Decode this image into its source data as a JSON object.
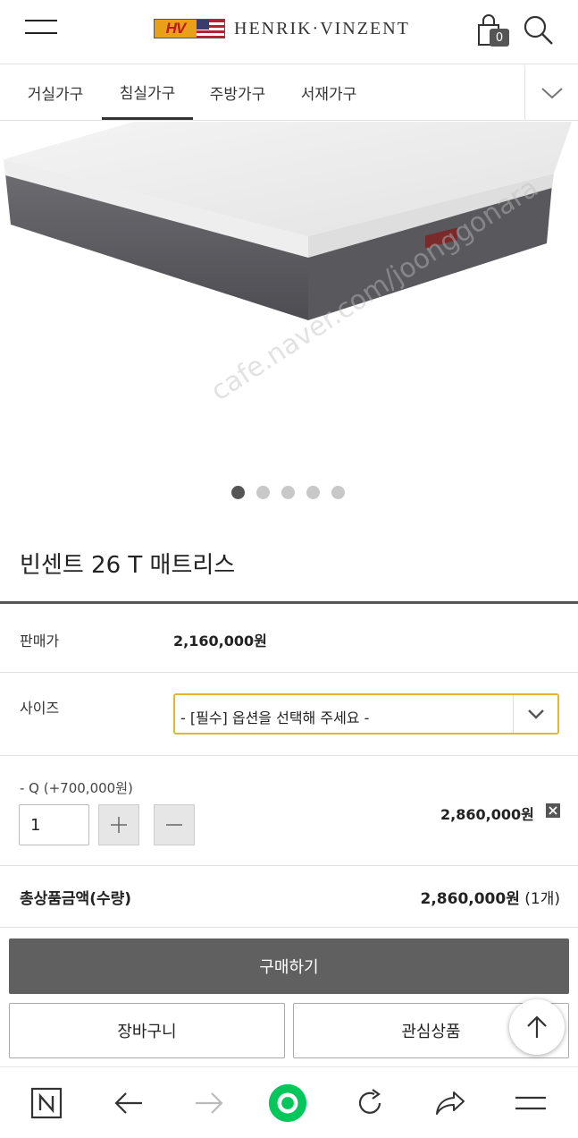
{
  "header": {
    "brand_mark": "HV",
    "brand_name": "HENRIK·VINZENT",
    "cart_count": "0"
  },
  "tabs": [
    {
      "label": "거실가구",
      "active": false
    },
    {
      "label": "침실가구",
      "active": true
    },
    {
      "label": "주방가구",
      "active": false
    },
    {
      "label": "서재가구",
      "active": false
    }
  ],
  "gallery": {
    "watermark": "cafe.naver.com/joonggonara",
    "slide_count": 5,
    "active_slide": 1
  },
  "product": {
    "title": "빈센트 26 T 매트리스",
    "price_label": "판매가",
    "price_value": "2,160,000원",
    "size_label": "사이즈",
    "size_select_value": "- [필수] 옵션을 선택해 주세요 -"
  },
  "selected_option": {
    "label": "- Q (+700,000원)",
    "quantity": "1",
    "price": "2,860,000원"
  },
  "total": {
    "label": "총상품금액(수량)",
    "price": "2,860,000원",
    "count": "(1개)"
  },
  "actions": {
    "buy": "구매하기",
    "cart": "장바구니",
    "wishlist": "관심상품"
  },
  "colors": {
    "accent_border": "#e2b631",
    "buy_button": "#606060",
    "browser_green": "#03c75a"
  }
}
